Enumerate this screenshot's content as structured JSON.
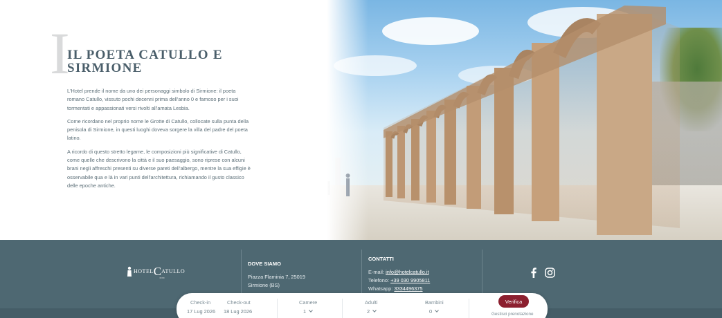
{
  "intro": {
    "initial": "I",
    "title": "IL POETA CATULLO E SIRMIONE",
    "paragraphs": [
      "L'Hotel prende il nome da uno dei personaggi simbolo di Sirmione: il poeta romano Catullo, vissuto pochi decenni prima dell'anno 0 e famoso per i suoi tormentati e appassionati versi rivolti all'amata Lesbia.",
      "Come ricordano nel proprio nome le Grotte di Catullo, collocate sulla punta della penisola di Sirmione, in questi luoghi doveva sorgere la villa del padre del poeta latino.",
      "A ricordo di questo stretto legame, le composizioni più significative di Catullo, come quelle che descrivono la città e il suo paesaggio, sono riprese con alcuni brani negli affreschi presenti su diverse pareti dell'albergo, mentre la sua effigie è osservabile qua e là in vari punti dell'architettura, richiamando il gusto classico delle epoche antiche."
    ]
  },
  "footer": {
    "logo": {
      "prefix": "HOTEL",
      "initial": "C",
      "rest": "ATULLO",
      "sub": "★★★"
    },
    "where": {
      "heading": "DOVE SIAMO",
      "line1": "Piazza Flaminia 7, 25019",
      "line2": "Sirmione (BS)"
    },
    "contacts": {
      "heading": "CONTATTI",
      "email_label": "E-mail:",
      "email": "info@hotelcatullo.it",
      "phone_label": "Telefono:",
      "phone": "+39 030 9905811",
      "whatsapp_label": "Whatsapp:",
      "whatsapp": "3334496375"
    },
    "social": [
      "facebook-icon",
      "instagram-icon"
    ]
  },
  "booking": {
    "checkin_label": "Check-in",
    "checkin_value": "17 Lug 2026",
    "checkout_label": "Check-out",
    "checkout_value": "18 Lug 2026",
    "rooms_label": "Camere",
    "rooms_value": "1",
    "adults_label": "Adulti",
    "adults_value": "2",
    "children_label": "Bambini",
    "children_value": "0",
    "verify_label": "Verifica",
    "manage_label": "Gestisci prenotazione"
  },
  "colors": {
    "footer_bg": "#4e6872",
    "title": "#4a5e6a",
    "accent_button": "#8c1f2f"
  }
}
